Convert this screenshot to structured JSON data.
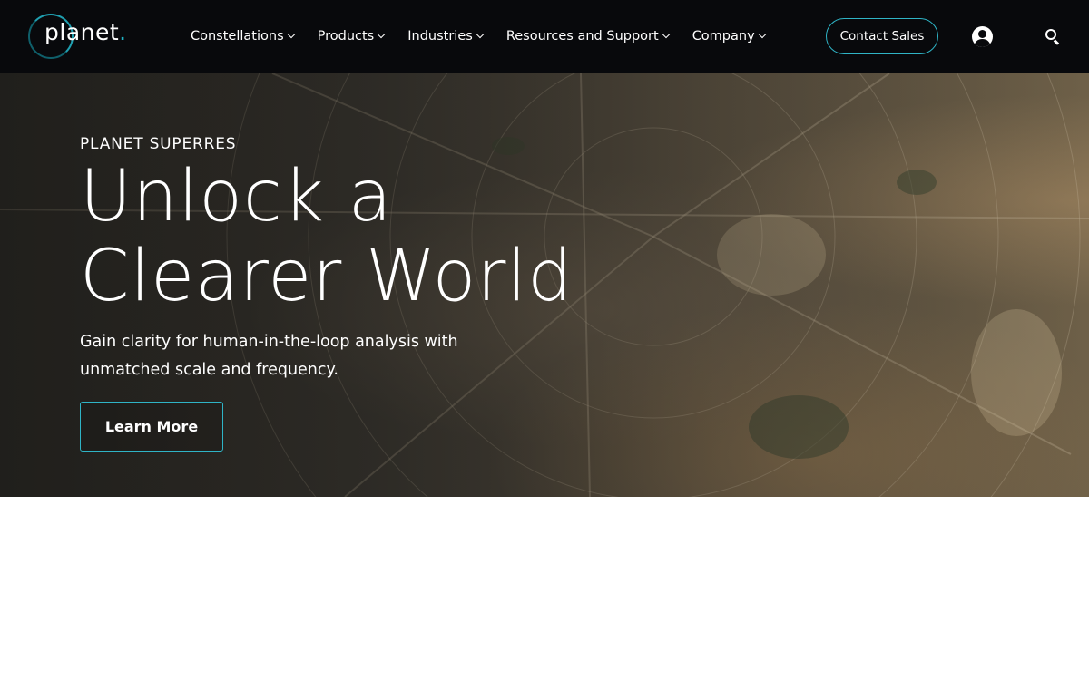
{
  "header": {
    "logo_text": "planet",
    "logo_dot": ".",
    "nav": [
      {
        "label": "Constellations"
      },
      {
        "label": "Products"
      },
      {
        "label": "Industries"
      },
      {
        "label": "Resources and Support"
      },
      {
        "label": "Company"
      }
    ],
    "contact_label": "Contact Sales",
    "icons": {
      "account": "user-circle-icon",
      "search": "search-icon",
      "dropdown": "chevron-down-icon"
    }
  },
  "hero": {
    "eyebrow": "PLANET SUPERRES",
    "headline_line1": "Unlock a",
    "headline_line2": "Clearer World",
    "subtext": "Gain clarity for human-in-the-loop analysis with unmatched scale and frequency.",
    "cta_label": "Learn More",
    "background": "satellite-imagery"
  },
  "colors": {
    "header_bg": "#08090c",
    "accent": "#2fb4c6",
    "text": "#ffffff",
    "page_bg": "#ffffff"
  }
}
